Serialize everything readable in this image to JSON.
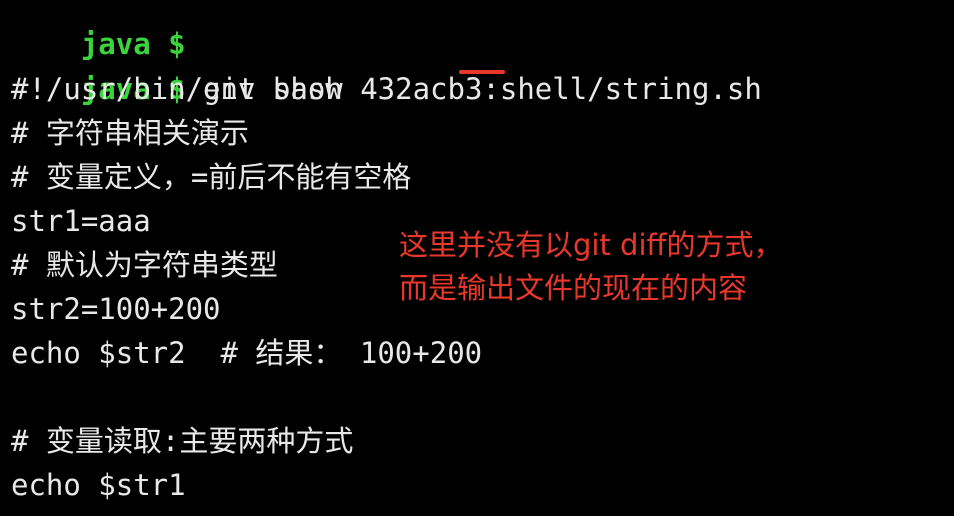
{
  "terminal": {
    "prompt_label": "java $",
    "previous_prompt": "java $",
    "command": "git show 432acb3:shell/string.sh",
    "output_lines": [
      "#!/usr/bin/env bash",
      "# 字符串相关演示",
      "# 变量定义，=前后不能有空格",
      "str1=aaa",
      "# 默认为字符串类型",
      "str2=100+200",
      "echo $str2  # 结果： 100+200",
      "",
      "# 变量读取:主要两种方式",
      "echo $str1"
    ]
  },
  "annotation": {
    "line1": "这里并没有以git diff的方式，",
    "line2": "而是输出文件的现在的内容"
  },
  "colors": {
    "background": "#000000",
    "prompt": "#3cd43c",
    "text": "#e8e8e8",
    "annotation": "#e8382c"
  }
}
